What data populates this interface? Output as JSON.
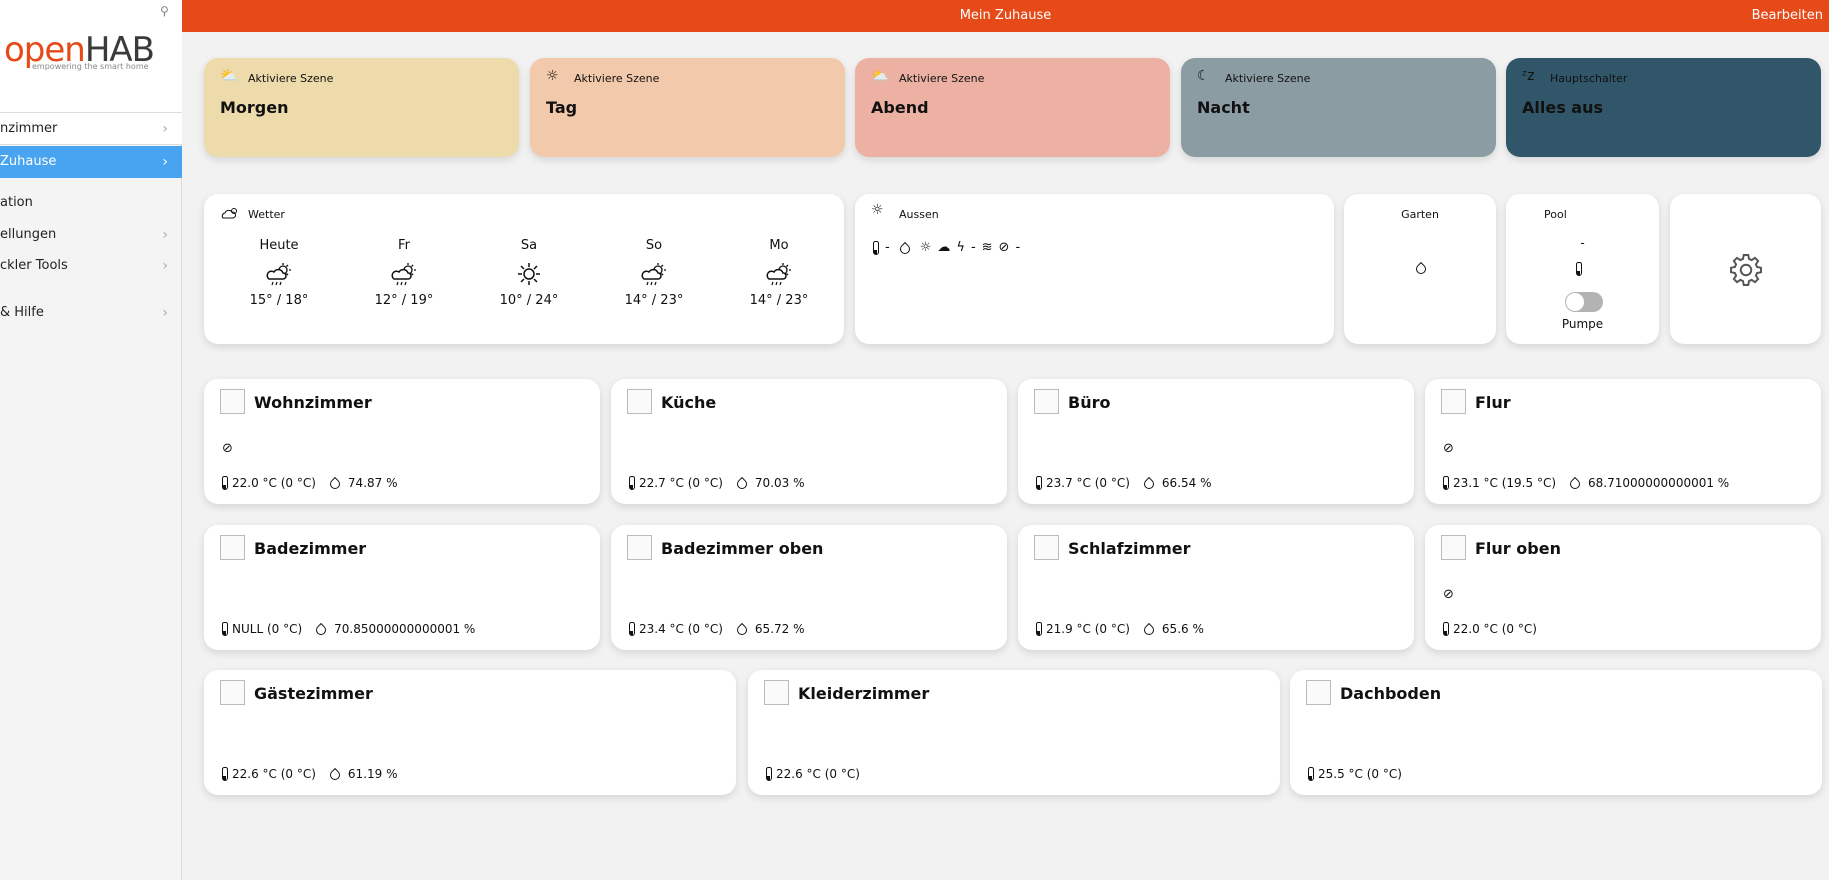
{
  "sidebar": {
    "logo_text_a": "open",
    "logo_text_b": "HAB",
    "logo_tagline": "empowering the smart home",
    "items": [
      {
        "label": "nzimmer"
      },
      {
        "label": "Zuhause"
      },
      {
        "label": "ation"
      },
      {
        "label": "ellungen"
      },
      {
        "label": "ckler Tools"
      },
      {
        "label": "& Hilfe"
      }
    ]
  },
  "header": {
    "title": "Mein Zuhause",
    "edit": "Bearbeiten"
  },
  "scenes": [
    {
      "label": "Aktiviere Szene",
      "title": "Morgen",
      "color": "#eedbac",
      "icon": "sunrise-icon"
    },
    {
      "label": "Aktiviere Szene",
      "title": "Tag",
      "color": "#f2c9ab",
      "icon": "sun-icon"
    },
    {
      "label": "Aktiviere Szene",
      "title": "Abend",
      "color": "#ecb1a3",
      "icon": "sunset-icon"
    },
    {
      "label": "Aktiviere Szene",
      "title": "Nacht",
      "color": "#8b9ca3",
      "icon": "moon-icon"
    },
    {
      "label": "Hauptschalter",
      "title": "Alles aus",
      "color": "#325669",
      "icon": "sleep-icon"
    }
  ],
  "weather": {
    "title": "Wetter",
    "days": [
      {
        "day": "Heute",
        "temp": "15° / 18°",
        "icon": "cloud-sun-rain-icon"
      },
      {
        "day": "Fr",
        "temp": "12° / 19°",
        "icon": "cloud-sun-rain-icon"
      },
      {
        "day": "Sa",
        "temp": "10° / 24°",
        "icon": "sun-icon"
      },
      {
        "day": "So",
        "temp": "14° / 23°",
        "icon": "cloud-sun-rain-icon"
      },
      {
        "day": "Mo",
        "temp": "14° / 23°",
        "icon": "cloud-sun-rain-icon"
      }
    ]
  },
  "aussen": {
    "title": "Aussen",
    "temp": "-",
    "lightning": "-",
    "wind_dir": "-"
  },
  "garten": {
    "title": "Garten"
  },
  "pool": {
    "title": "Pool",
    "temp": "-",
    "switch_label": "Pumpe",
    "switch_on": false
  },
  "rooms": [
    {
      "name": "Wohnzimmer",
      "light": true,
      "temp": "22.0 °C (0 °C)",
      "hum": "74.87 %"
    },
    {
      "name": "Küche",
      "light": false,
      "temp": "22.7 °C (0 °C)",
      "hum": "70.03 %"
    },
    {
      "name": "Büro",
      "light": false,
      "temp": "23.7 °C (0 °C)",
      "hum": "66.54 %"
    },
    {
      "name": "Flur",
      "light": true,
      "temp": "23.1 °C (19.5 °C)",
      "hum": "68.71000000000001 %"
    },
    {
      "name": "Badezimmer",
      "light": false,
      "temp": "NULL (0 °C)",
      "hum": "70.85000000000001 %"
    },
    {
      "name": "Badezimmer oben",
      "light": false,
      "temp": "23.4 °C (0 °C)",
      "hum": "65.72 %"
    },
    {
      "name": "Schlafzimmer",
      "light": false,
      "temp": "21.9 °C (0 °C)",
      "hum": "65.6 %"
    },
    {
      "name": "Flur oben",
      "light": true,
      "temp": "22.0 °C (0 °C)",
      "hum": null
    },
    {
      "name": "Gästezimmer",
      "light": false,
      "temp": "22.6 °C (0 °C)",
      "hum": "61.19 %"
    },
    {
      "name": "Kleiderzimmer",
      "light": false,
      "temp": "22.6 °C (0 °C)",
      "hum": null
    },
    {
      "name": "Dachboden",
      "light": false,
      "temp": "25.5 °C (0 °C)",
      "hum": null
    }
  ]
}
